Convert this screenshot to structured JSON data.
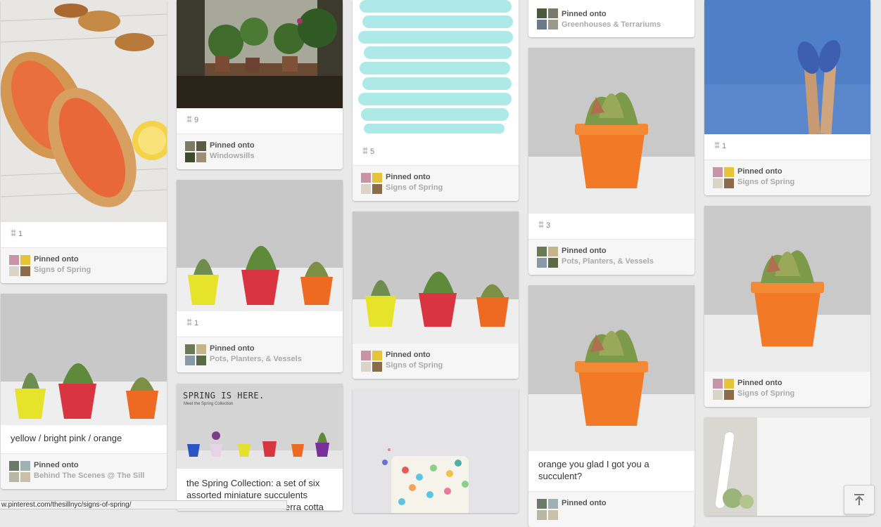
{
  "colors": {
    "background": "#e9e9e9",
    "card": "#ffffff",
    "attribution_bg": "#f6f6f6",
    "pinned_text": "#555555",
    "board_text": "#aaaaaa"
  },
  "common": {
    "pinned_onto": "Pinned onto",
    "repin_icon": "pin-icon"
  },
  "pins": {
    "c1p1": {
      "repins": "1",
      "board": "Signs of Spring"
    },
    "c1p2": {
      "description": "yellow / bright pink / orange",
      "board": "Behind The Scenes @ The Sill"
    },
    "c2p1": {
      "repins": "9",
      "board": "Windowsills"
    },
    "c2p2": {
      "repins": "1",
      "board": "Pots, Planters, & Vessels"
    },
    "c2p3": {
      "image_text": "SPRING IS HERE.",
      "image_subtext": "Meet the Spring Collection",
      "description": "the Spring Collection: a set of six assorted miniature succulents",
      "description_cont": "erra cotta"
    },
    "c3p1": {
      "repins": "5",
      "board": "Signs of Spring"
    },
    "c3p2": {
      "board": "Signs of Spring"
    },
    "c4p1": {
      "board": "Greenhouses & Terrariums"
    },
    "c4p2": {
      "repins": "3",
      "board": "Pots, Planters, & Vessels"
    },
    "c4p3": {
      "description": "orange you glad I got you a succulent?"
    },
    "c5p1": {
      "repins": "1",
      "board": "Signs of Spring"
    },
    "c5p2": {
      "board": "Signs of Spring"
    }
  },
  "status_url": "w.pinterest.com/thesillnyc/signs-of-spring/",
  "scroll_top_icon": "arrow-up-to-top-icon"
}
